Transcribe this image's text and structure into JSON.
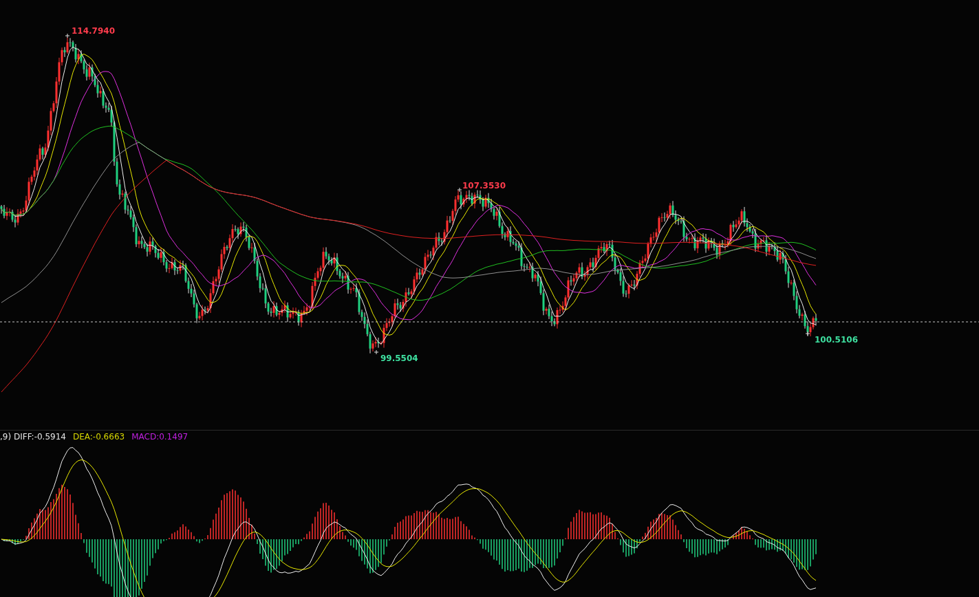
{
  "price_chart": {
    "annotations": [
      {
        "kind": "high",
        "text": "114.7940"
      },
      {
        "kind": "high",
        "text": "107.3530"
      },
      {
        "kind": "low",
        "text": "99.5504"
      },
      {
        "kind": "low",
        "text": "100.5106"
      }
    ]
  },
  "macd_panel": {
    "legend": [
      {
        "text": ",9) DIFF:-0.5914",
        "color": "#e6e6e6"
      },
      {
        "text": "DEA:-0.6663",
        "color": "#d8d800"
      },
      {
        "text": "MACD:0.1497",
        "color": "#c020e0"
      }
    ]
  }
}
